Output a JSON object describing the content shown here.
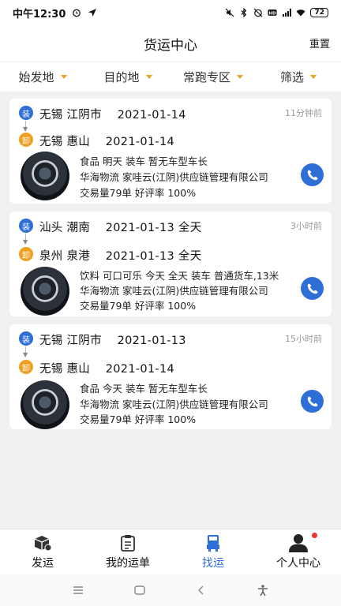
{
  "status": {
    "time": "中午12:30",
    "battery": "72"
  },
  "header": {
    "title": "货运中心",
    "reset_label": "重置"
  },
  "filters": [
    {
      "label": "始发地"
    },
    {
      "label": "目的地"
    },
    {
      "label": "常跑专区"
    },
    {
      "label": "筛选"
    }
  ],
  "badges": {
    "load": "装",
    "unload": "卸"
  },
  "cards": [
    {
      "from": "无锡 江阴市",
      "from_date": "2021-01-14",
      "to": "无锡 惠山",
      "to_date": "2021-01-14",
      "ago": "11分钟前",
      "goods": "食品    明天    装车  暂无车型车长",
      "company": "华海物流   家哇云(江阴)供应链管理有限公司",
      "stats": "交易量79单     好评率  100%"
    },
    {
      "from": "汕头 潮南",
      "from_date": "2021-01-13 全天",
      "to": "泉州 泉港",
      "to_date": "2021-01-13 全天",
      "ago": "3小时前",
      "goods": "饮料  可口可乐  今天  全天  装车  普通货车,13米",
      "company": "华海物流   家哇云(江阴)供应链管理有限公司",
      "stats": "交易量79单     好评率  100%"
    },
    {
      "from": "无锡 江阴市",
      "from_date": "2021-01-13",
      "to": "无锡 惠山",
      "to_date": "2021-01-14",
      "ago": "15小时前",
      "goods": "食品    今天    装车  暂无车型车长",
      "company": "华海物流   家哇云(江阴)供应链管理有限公司",
      "stats": "交易量79单     好评率  100%"
    }
  ],
  "tabs": [
    {
      "label": "发运",
      "icon": "package-icon"
    },
    {
      "label": "我的运单",
      "icon": "clipboard-icon"
    },
    {
      "label": "找运",
      "icon": "truck-icon"
    },
    {
      "label": "个人中心",
      "icon": "person-icon"
    }
  ],
  "colors": {
    "accent": "#2d6fd6",
    "caret": "#f0a020",
    "unread_dot": "#e33333"
  }
}
